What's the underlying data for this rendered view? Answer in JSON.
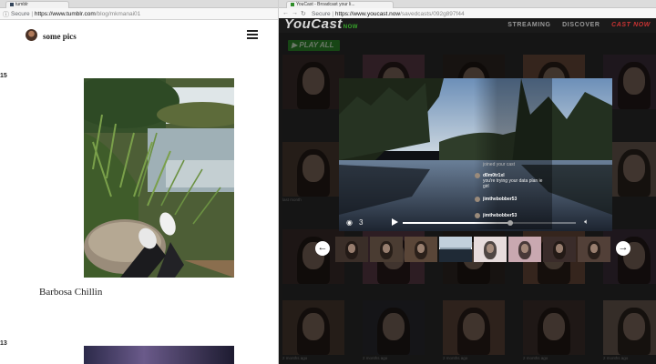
{
  "left_window": {
    "tab_title": "tumblr",
    "address": {
      "secure_label": "Secure",
      "url_domain": "https://www.tumblr.com",
      "url_path": "/blog/mkmanai01"
    },
    "blog": {
      "title": "some pics",
      "posts": [
        {
          "number": "15",
          "caption": "Barbosa Chillin"
        },
        {
          "number": "13",
          "caption": ""
        }
      ]
    }
  },
  "right_window": {
    "tab_title": "YouCast - Broadcast your li...",
    "address": {
      "secure_label": "Secure",
      "url_domain": "https://www.youcast.now",
      "url_path": "/savedcasts/092g897f44"
    },
    "site": {
      "logo": "YouCast",
      "logo_suffix": "NOW",
      "nav": [
        "STREAMING",
        "DISCOVER",
        "CAST NOW"
      ],
      "play_all_label": "PLAY ALL"
    },
    "grid_timestamps": [
      "last month",
      "2 months ago",
      "2 months ago",
      "2 months ago",
      "2 months ago",
      "2 months ago",
      "2 months ago",
      "2 months ago",
      "2 months ago"
    ],
    "player": {
      "view_count": "3",
      "progress": 0.62,
      "chat": [
        {
          "user": "",
          "text": "joined your cast"
        },
        {
          "user": "d0m0tr1xl",
          "text": "you're trying your data plan ie girl"
        },
        {
          "user": "jimthebobber53",
          "text": ""
        },
        {
          "user": "jimthebobber53",
          "text": ""
        }
      ]
    },
    "carousel": {
      "count": 8,
      "selected_index": 3
    }
  },
  "colors": {
    "youcast_green": "#2f8d2a",
    "cast_now_red": "#cc3333",
    "tumblr_navy": "#35465c"
  }
}
